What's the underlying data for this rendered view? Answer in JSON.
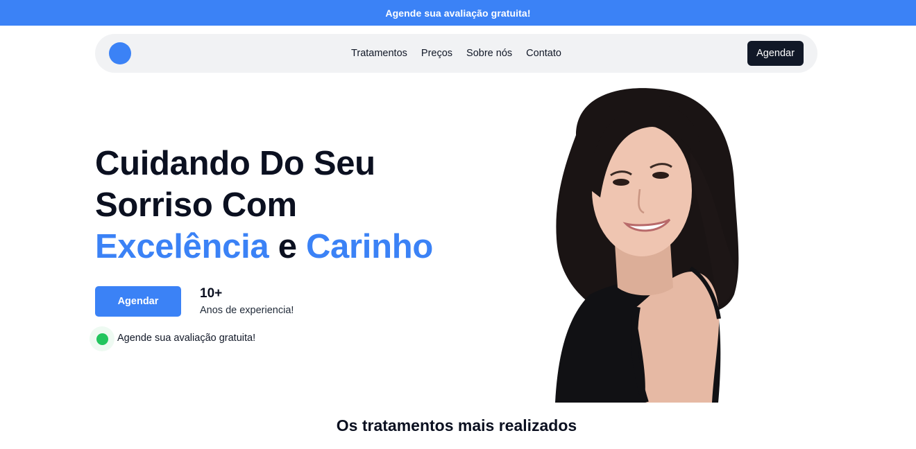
{
  "announcement": {
    "text": "Agende sua avaliação gratuita!"
  },
  "nav": {
    "links": [
      "Tratamentos",
      "Preços",
      "Sobre nós",
      "Contato"
    ],
    "cta_label": "Agendar"
  },
  "hero": {
    "headline_line1": "Cuidando Do Seu",
    "headline_line2": "Sorriso Com",
    "headline_accent1": "Excelência",
    "headline_connector": "e",
    "headline_accent2": "Carinho",
    "cta_label": "Agendar",
    "stat_value": "10+",
    "stat_label": "Anos de experiencia!",
    "note": "Agende sua avaliação gratuita!"
  },
  "section": {
    "title": "Os tratamentos mais realizados"
  },
  "colors": {
    "primary": "#3b82f6",
    "dark": "#111827",
    "success": "#22c55e",
    "nav_bg": "#f1f2f4"
  }
}
